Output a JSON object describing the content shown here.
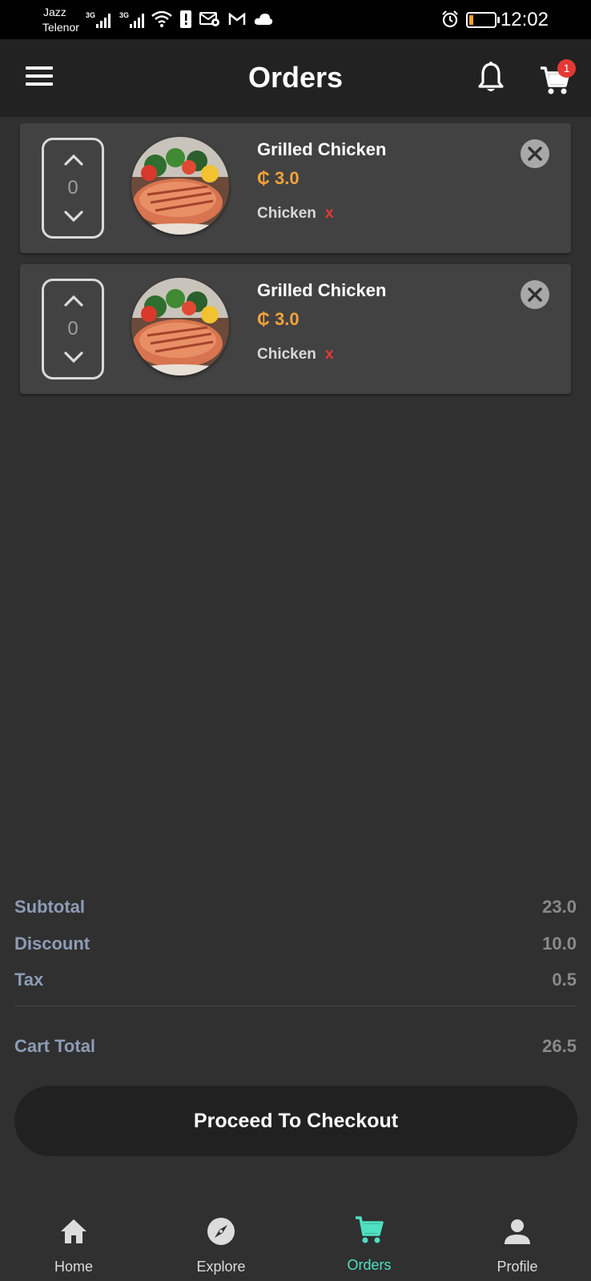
{
  "status_bar": {
    "carrier_1": "Jazz",
    "carrier_2": "Telenor",
    "network_1": "3G",
    "network_2": "3G",
    "time": "12:02",
    "battery_level": 0.18,
    "icons": [
      "signal-icon",
      "signal-icon",
      "wifi-icon",
      "alert-icon",
      "mail-settings-icon",
      "gmail-icon",
      "cloud-icon",
      "alarm-icon",
      "battery-icon"
    ]
  },
  "app_bar": {
    "title": "Orders",
    "cart_badge": "1",
    "icons": [
      "menu-icon",
      "bell-icon",
      "cart-icon"
    ]
  },
  "orders": [
    {
      "name": "Grilled Chicken",
      "price": "₵ 3.0",
      "quantity": "0",
      "tag": "Chicken",
      "tag_remove": "x"
    },
    {
      "name": "Grilled Chicken",
      "price": "₵ 3.0",
      "quantity": "0",
      "tag": "Chicken",
      "tag_remove": "x"
    }
  ],
  "totals": {
    "subtotal_label": "Subtotal",
    "subtotal_value": "23.0",
    "discount_label": "Discount",
    "discount_value": "10.0",
    "tax_label": "Tax",
    "tax_value": "0.5",
    "cart_total_label": "Cart Total",
    "cart_total_value": "26.5"
  },
  "checkout_label": "Proceed To Checkout",
  "bottom_nav": [
    {
      "label": "Home",
      "icon": "home-icon"
    },
    {
      "label": "Explore",
      "icon": "compass-icon"
    },
    {
      "label": "Orders",
      "icon": "cart-icon",
      "active": true
    },
    {
      "label": "Profile",
      "icon": "person-icon"
    }
  ],
  "colors": {
    "background": "#303030",
    "app_bar": "#222222",
    "card": "#424242",
    "price": "#f4a33a",
    "accent_active": "#4de1c1",
    "remove_tag": "#e53935",
    "totals_label": "#8e9cb6"
  }
}
